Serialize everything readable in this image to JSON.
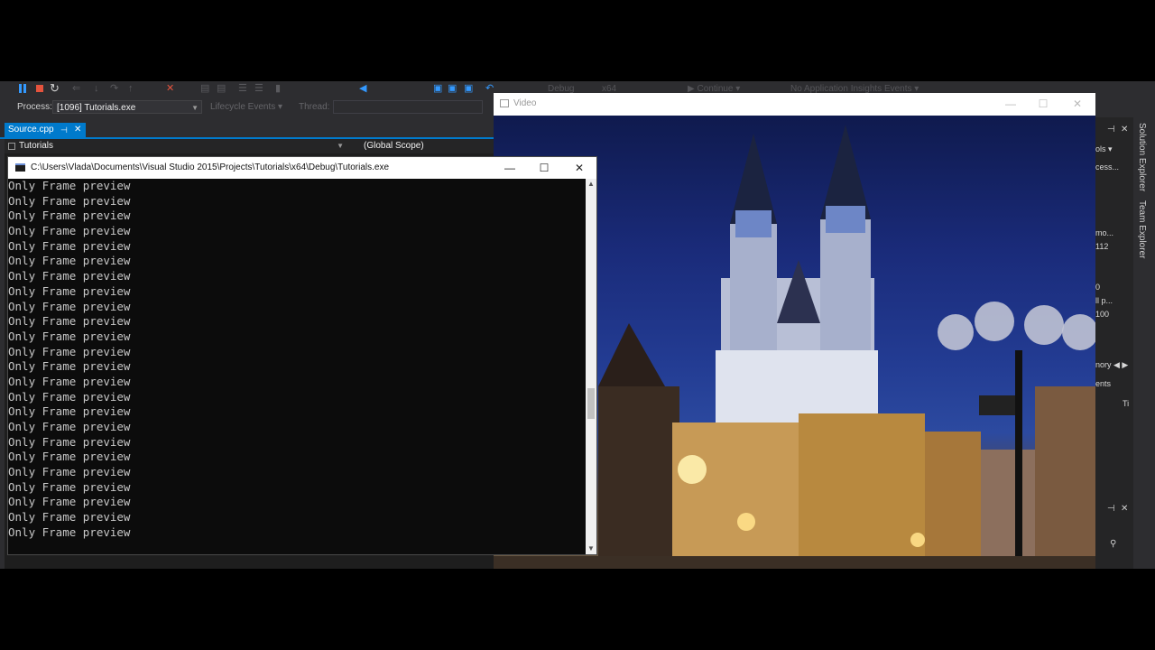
{
  "vs": {
    "process_label": "Process:",
    "process_value": "[1096] Tutorials.exe",
    "lifecycle_label": "Lifecycle Events ▾",
    "thread_label": "Thread:",
    "debug_config": "Debug",
    "platform": "x64",
    "continue_label": "▶ Continue ▾",
    "insights_label": "No Application Insights Events ▾",
    "doc_tab": "Source.cpp",
    "nav_project": "Tutorials",
    "nav_scope": "(Global Scope)",
    "side_tabs": [
      "Solution Explorer",
      "Team Explorer"
    ],
    "right_panel_fragments": [
      "ols ▾",
      "cess...",
      "mo...",
      "112",
      "0",
      "ll p...",
      "100",
      "nory ◀ ▶",
      "ents",
      "Ti"
    ]
  },
  "console": {
    "title": "C:\\Users\\Vlada\\Documents\\Visual Studio 2015\\Projects\\Tutorials\\x64\\Debug\\Tutorials.exe",
    "lines": [
      "Only Frame preview",
      "Only Frame preview",
      "Only Frame preview",
      "Only Frame preview",
      "Only Frame preview",
      "Only Frame preview",
      "Only Frame preview",
      "Only Frame preview",
      "Only Frame preview",
      "Only Frame preview",
      "Only Frame preview",
      "Only Frame preview",
      "Only Frame preview",
      "Only Frame preview",
      "Only Frame preview",
      "Only Frame preview",
      "Only Frame preview",
      "Only Frame preview",
      "Only Frame preview",
      "Only Frame preview",
      "Only Frame preview",
      "Only Frame preview",
      "Only Frame preview",
      "Only Frame preview"
    ]
  },
  "video": {
    "title": "Video"
  }
}
